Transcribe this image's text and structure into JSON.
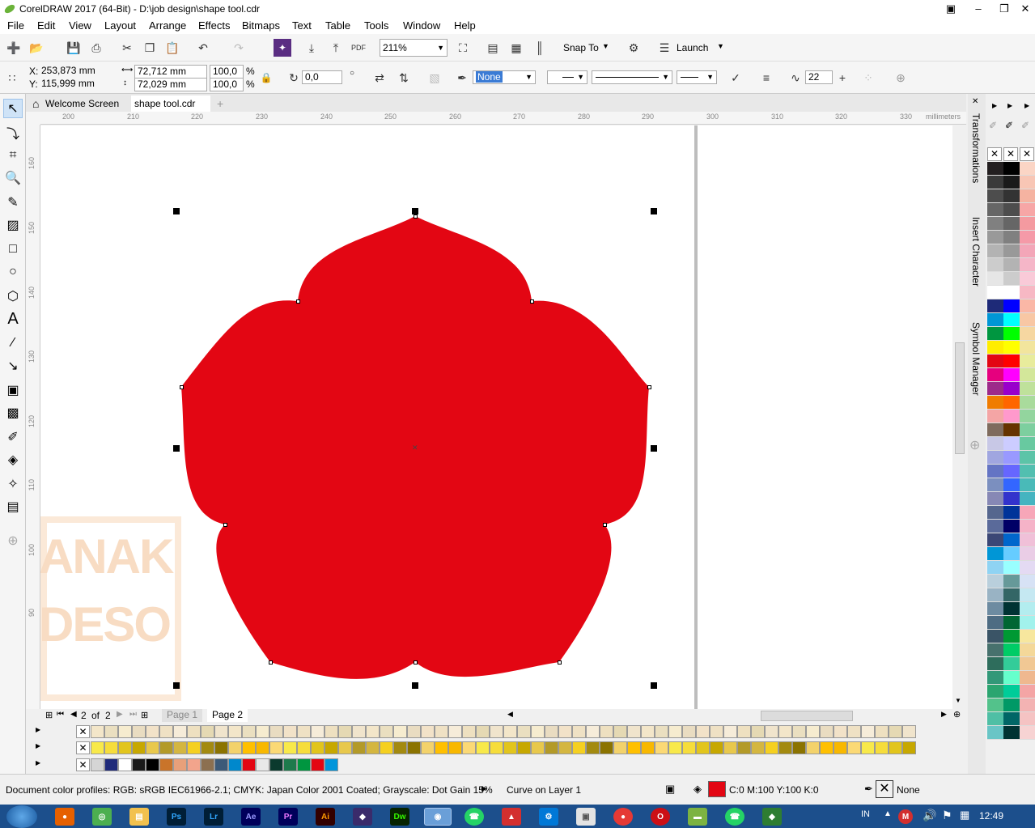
{
  "title": "CorelDRAW 2017 (64-Bit) - D:\\job design\\shape tool.cdr",
  "menu": [
    "File",
    "Edit",
    "View",
    "Layout",
    "Arrange",
    "Effects",
    "Bitmaps",
    "Text",
    "Table",
    "Tools",
    "Window",
    "Help"
  ],
  "toolbar": {
    "zoom": "211%",
    "snap_to": "Snap To",
    "launch": "Launch"
  },
  "props": {
    "x_label": "X:",
    "x": "253,873 mm",
    "y_label": "Y:",
    "y": "115,999 mm",
    "w": "72,712 mm",
    "h": "72,029 mm",
    "sx": "100,0",
    "sy": "100,0",
    "pct": "%",
    "rotation": "0,0",
    "outline": "None",
    "smoothing": "22"
  },
  "tabs": {
    "welcome": "Welcome Screen",
    "doc": "shape tool.cdr"
  },
  "ruler": {
    "h_ticks": [
      "200",
      "210",
      "220",
      "230",
      "240",
      "250",
      "260",
      "270",
      "280",
      "290",
      "300",
      "310",
      "320",
      "330"
    ],
    "unit": "millimeters",
    "v_ticks": [
      "160",
      "150",
      "140",
      "130",
      "120",
      "110",
      "100",
      "90"
    ]
  },
  "pages": {
    "current": "2",
    "of": "of",
    "total": "2",
    "page1": "Page 1",
    "page2": "Page 2"
  },
  "watermark": [
    "ANAK",
    "DESO"
  ],
  "shape_fill": "#e30613",
  "dockers": [
    "Transformations",
    "Insert Character",
    "Symbol Manager"
  ],
  "status": {
    "profiles": "Document color profiles: RGB: sRGB IEC61966-2.1; CMYK: Japan Color 2001 Coated; Grayscale: Dot Gain 15%",
    "object": "Curve on Layer 1",
    "fill": "C:0 M:100 Y:100 K:0",
    "outline": "None"
  },
  "taskbar": {
    "lang": "IN",
    "time": "12:49",
    "apps": [
      "Ps",
      "Lr",
      "Ae",
      "Pr",
      "Ai",
      "Dw"
    ]
  }
}
